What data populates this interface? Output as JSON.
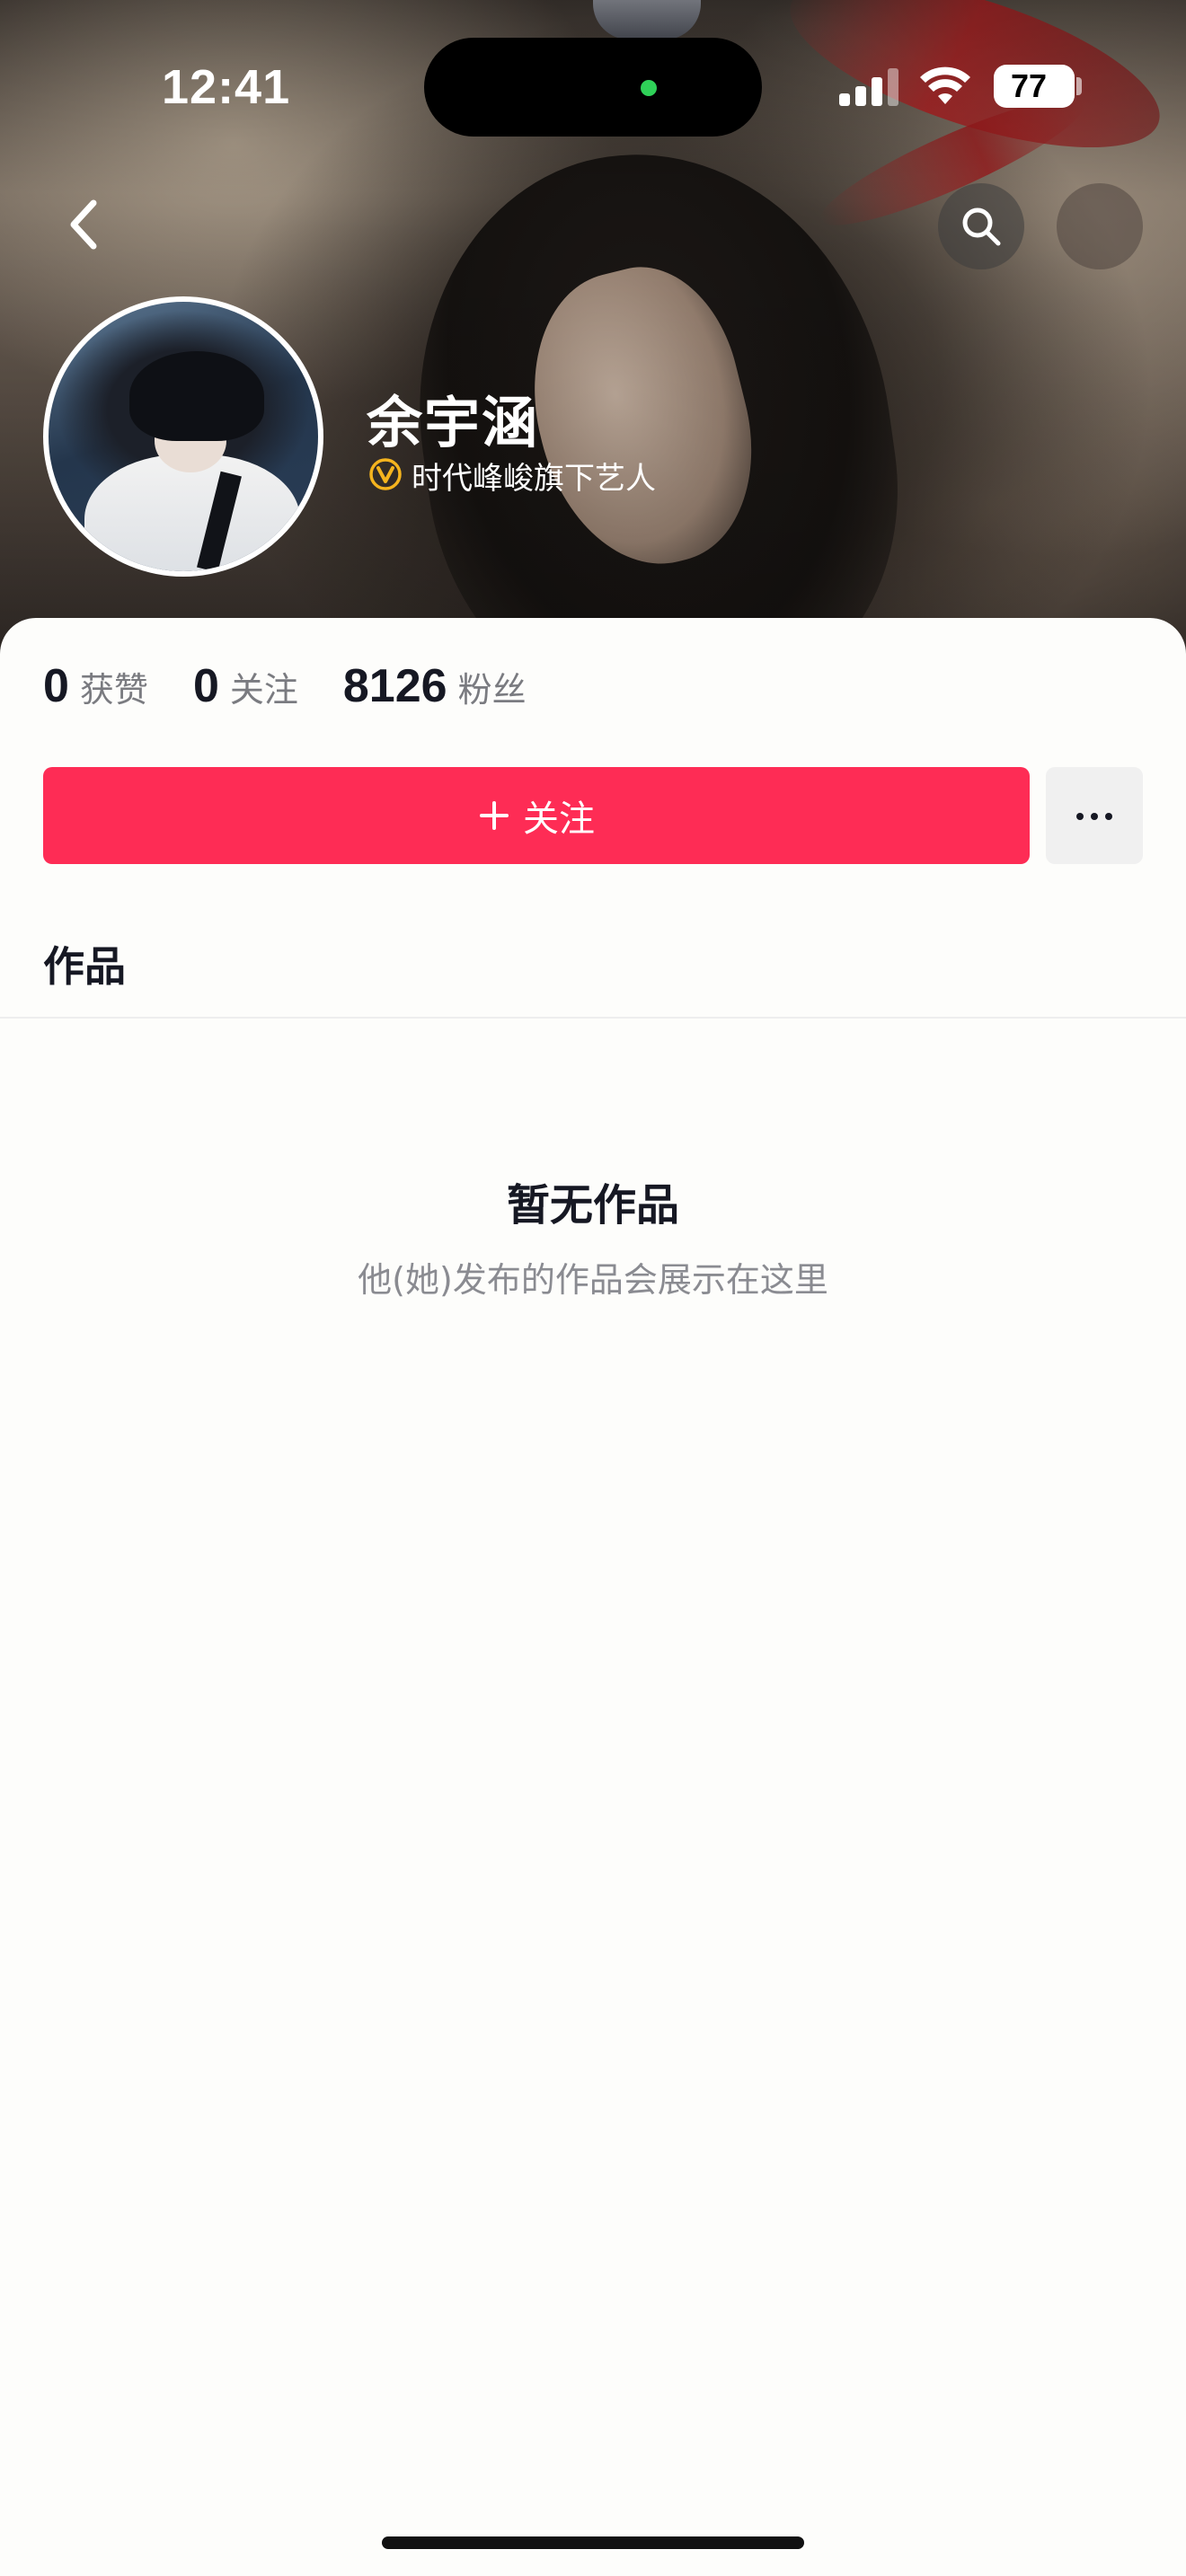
{
  "status_bar": {
    "time": "12:41",
    "battery": "77",
    "camera_indicator_color": "#2fd158"
  },
  "nav": {
    "back_icon": "chevron-left-icon",
    "search_icon": "search-icon"
  },
  "profile": {
    "name": "余宇涵",
    "verification_label": "时代峰峻旗下艺人",
    "verification_icon": "verified-v-badge-icon",
    "verification_color": "#f5b41e"
  },
  "stats": [
    {
      "value": "0",
      "label": "获赞"
    },
    {
      "value": "0",
      "label": "关注"
    },
    {
      "value": "8126",
      "label": "粉丝"
    }
  ],
  "actions": {
    "follow_label": "关注",
    "follow_color": "#fe2c55",
    "more_icon": "more-dots-icon"
  },
  "tabs": {
    "works": "作品"
  },
  "empty_state": {
    "title": "暂无作品",
    "subtitle": "他(她)发布的作品会展示在这里"
  }
}
